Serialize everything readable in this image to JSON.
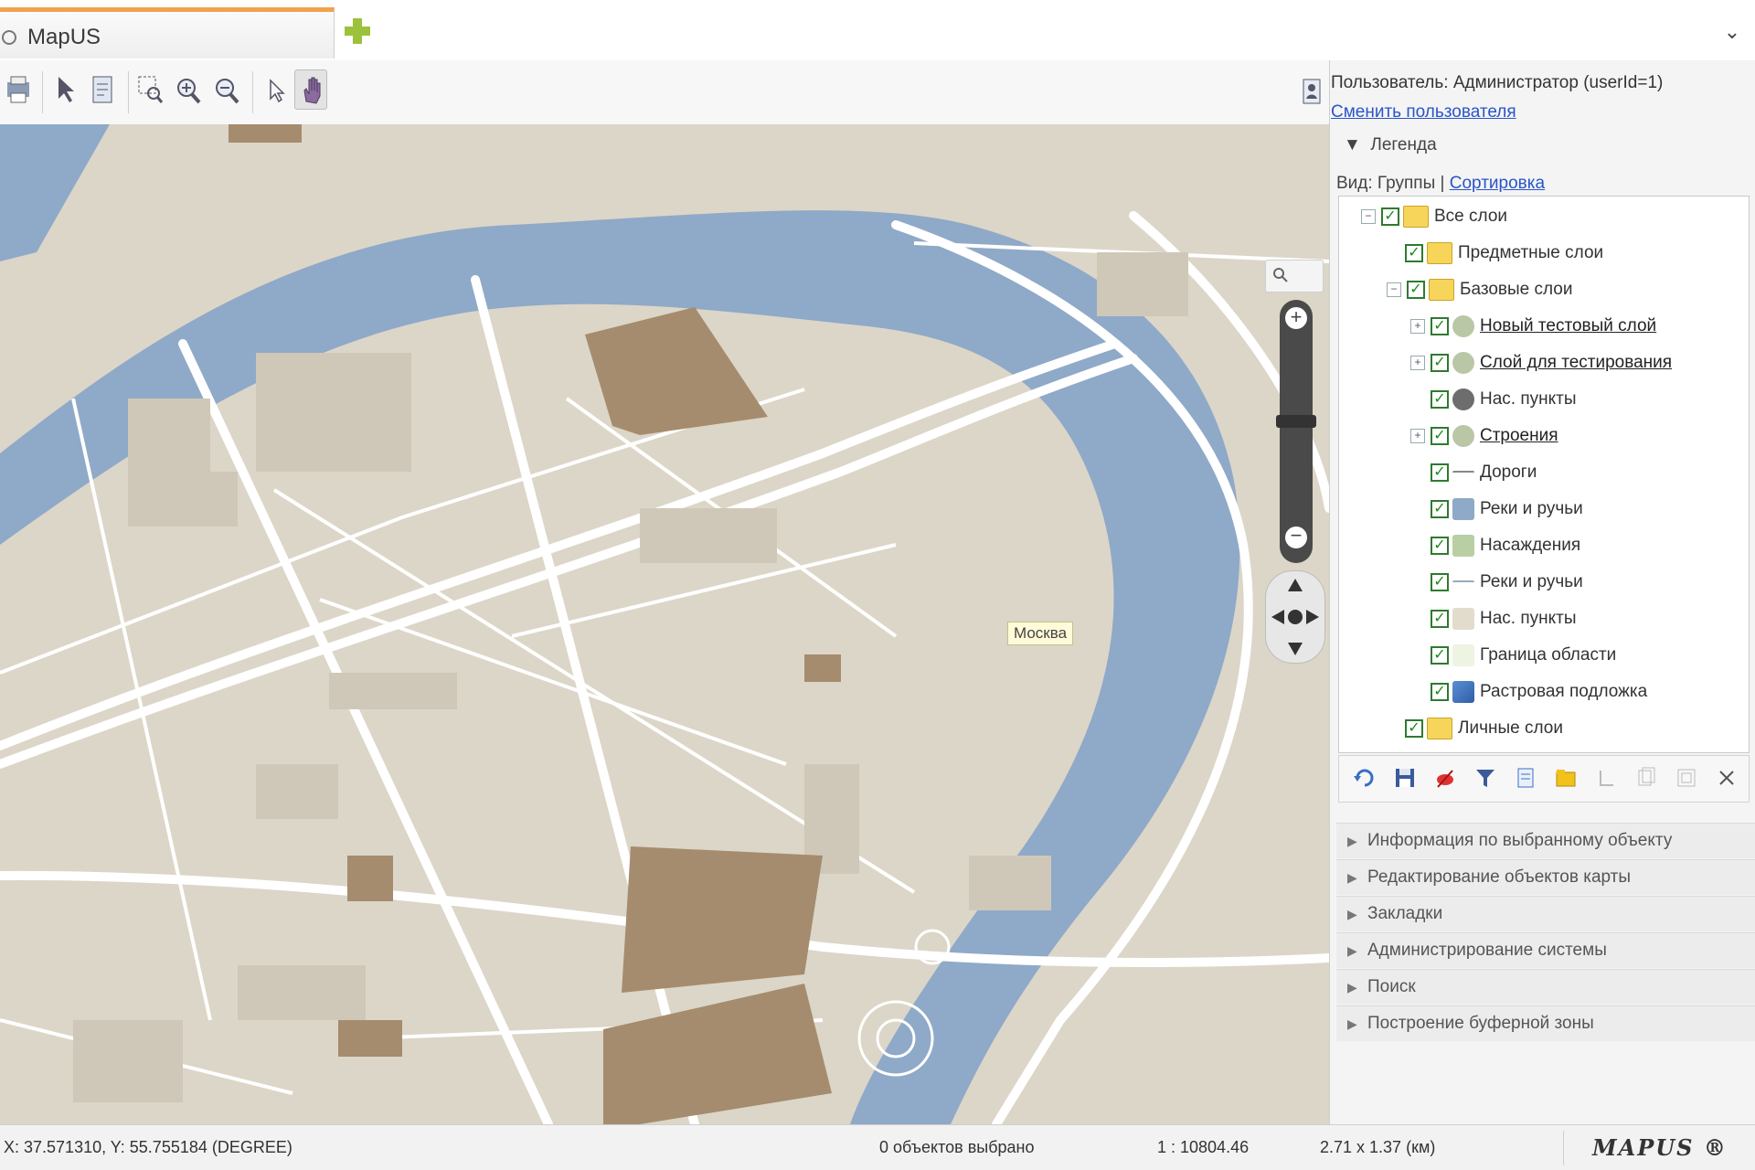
{
  "tab": {
    "title": "MapUS"
  },
  "user": {
    "label": "Пользователь: Администратор (userId=1)",
    "change_link": "Сменить пользователя"
  },
  "legend": {
    "title": "Легенда",
    "view_label": "Вид: Группы",
    "view_link": "Сортировка",
    "tree": [
      {
        "label": "Все слои",
        "icon": "folder-icon",
        "checked": true,
        "expanded": true
      },
      {
        "label": "Предметные слои",
        "icon": "folder-icon",
        "checked": true
      },
      {
        "label": "Базовые слои",
        "icon": "folder-icon",
        "checked": true,
        "expanded": true
      },
      {
        "label": "Новый тестовый слой",
        "icon": "layer-group-icon",
        "checked": true,
        "link": true
      },
      {
        "label": "Слой для тестирования",
        "icon": "layer-group-icon",
        "checked": true,
        "link": true
      },
      {
        "label": "Нас. пункты",
        "icon": "circle-layer-icon",
        "checked": true
      },
      {
        "label": "Строения",
        "icon": "layer-group-icon",
        "checked": true,
        "link": true
      },
      {
        "label": "Дороги",
        "icon": "line-layer-icon",
        "checked": true
      },
      {
        "label": "Реки и ручьи",
        "icon": "water-polygon-icon",
        "checked": true
      },
      {
        "label": "Насаждения",
        "icon": "green-polygon-icon",
        "checked": true
      },
      {
        "label": "Реки и ручьи",
        "icon": "line-layer-icon",
        "checked": true
      },
      {
        "label": "Нас. пункты",
        "icon": "beige-polygon-icon",
        "checked": true
      },
      {
        "label": "Граница области",
        "icon": "boundary-icon",
        "checked": true
      },
      {
        "label": "Растровая подложка",
        "icon": "raster-icon",
        "checked": true
      },
      {
        "label": "Личные слои",
        "icon": "folder-icon",
        "checked": true
      }
    ]
  },
  "accordion": [
    "Информация по выбранному объекту",
    "Редактирование объектов карты",
    "Закладки",
    "Администрирование системы",
    "Поиск",
    "Построение буферной зоны"
  ],
  "map": {
    "label": "Москва"
  },
  "status": {
    "coordinates": "X: 37.571310, Y: 55.755184 (DEGREE)",
    "selection": "0 объектов выбрано",
    "scale": "1 : 10804.46",
    "size": "2.71 x 1.37 (км)",
    "brand": "MAPUS ®"
  },
  "colors": {
    "water": "#8fa9c8",
    "land": "#dcd6c8",
    "building": "#a58c6e",
    "tab_accent": "#f0a24c",
    "link": "#2a55c8"
  }
}
